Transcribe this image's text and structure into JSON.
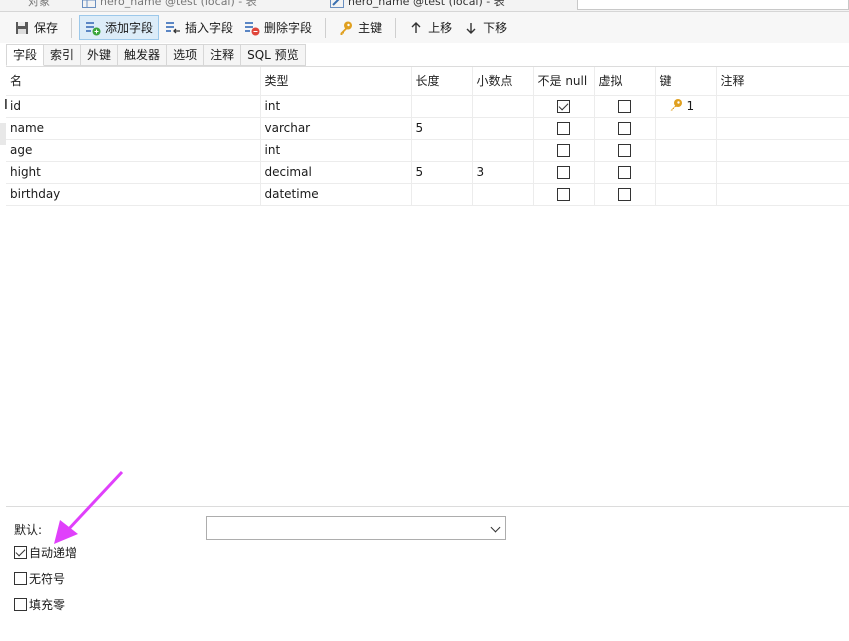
{
  "window_tabs": [
    {
      "label": "对象"
    },
    {
      "label": "hero_name @test (local) - 表"
    },
    {
      "label": "hero_name @test (local) - 表"
    }
  ],
  "toolbar": {
    "save_label": "保存",
    "add_field_label": "添加字段",
    "insert_field_label": "插入字段",
    "delete_field_label": "删除字段",
    "primary_key_label": "主键",
    "move_up_label": "上移",
    "move_down_label": "下移"
  },
  "subtabs": [
    "字段",
    "索引",
    "外键",
    "触发器",
    "选项",
    "注释",
    "SQL 预览"
  ],
  "grid": {
    "columns": [
      "名",
      "类型",
      "长度",
      "小数点",
      "不是 null",
      "虚拟",
      "键",
      "注释"
    ],
    "rows": [
      {
        "name": "id",
        "type": "int",
        "length": "",
        "decimals": "",
        "not_null": true,
        "virtual": false,
        "key": "1",
        "comment": ""
      },
      {
        "name": "name",
        "type": "varchar",
        "length": "5",
        "decimals": "",
        "not_null": false,
        "virtual": false,
        "key": "",
        "comment": ""
      },
      {
        "name": "age",
        "type": "int",
        "length": "",
        "decimals": "",
        "not_null": false,
        "virtual": false,
        "key": "",
        "comment": ""
      },
      {
        "name": "hight",
        "type": "decimal",
        "length": "5",
        "decimals": "3",
        "not_null": false,
        "virtual": false,
        "key": "",
        "comment": ""
      },
      {
        "name": "birthday",
        "type": "datetime",
        "length": "",
        "decimals": "",
        "not_null": false,
        "virtual": false,
        "key": "",
        "comment": ""
      }
    ]
  },
  "properties": {
    "default_label": "默认:",
    "default_value": "",
    "auto_increment_label": "自动递增",
    "auto_increment_checked": true,
    "unsigned_label": "无符号",
    "unsigned_checked": false,
    "zerofill_label": "填充零",
    "zerofill_checked": false
  },
  "colors": {
    "accent_active": "#dcecf8",
    "annotation_arrow": "#e040fb",
    "key_icon": "#e0a020"
  }
}
